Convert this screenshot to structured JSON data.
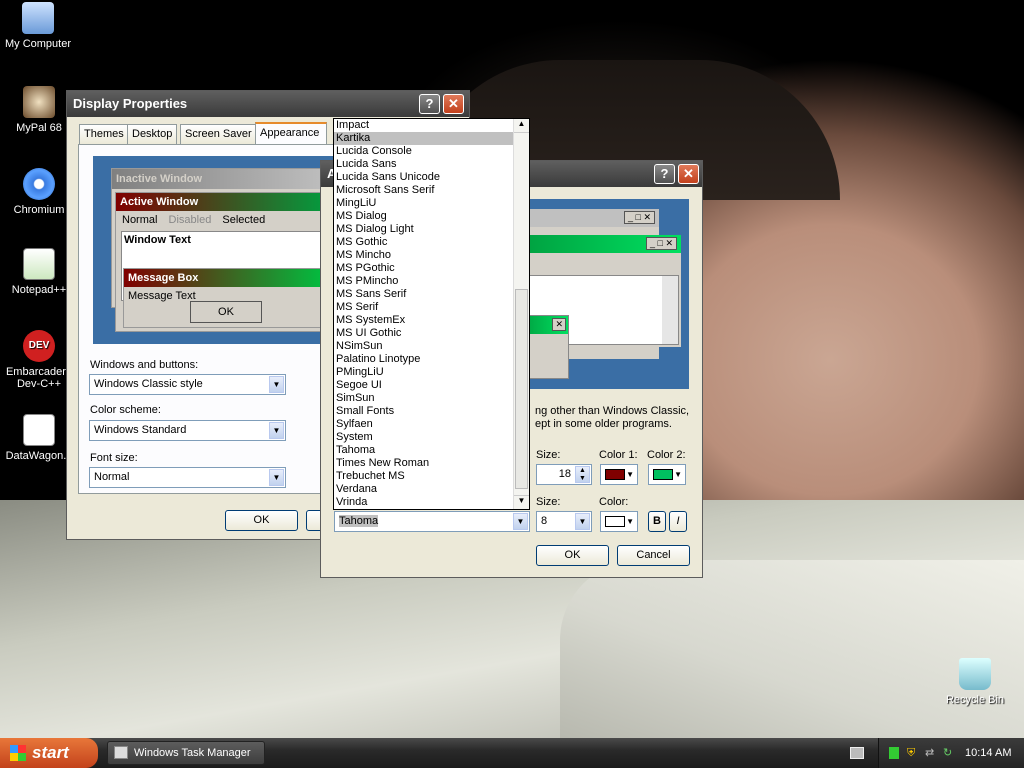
{
  "desktop": {
    "icons": [
      {
        "label": "My Computer"
      },
      {
        "label": "MyPal 68"
      },
      {
        "label": "Chromium"
      },
      {
        "label": "Notepad++"
      },
      {
        "label": "Embarcadero Dev-C++"
      },
      {
        "label": "DataWagon..."
      },
      {
        "label": "Recycle Bin"
      }
    ]
  },
  "display_props": {
    "title": "Display Properties",
    "tabs": [
      "Themes",
      "Desktop",
      "Screen Saver",
      "Appearance"
    ],
    "preview": {
      "inactive": "Inactive Window",
      "active": "Active Window",
      "menu_normal": "Normal",
      "menu_disabled": "Disabled",
      "menu_selected": "Selected",
      "window_text": "Window Text",
      "msgbox_title": "Message Box",
      "msgbox_text": "Message Text",
      "msgbox_ok": "OK"
    },
    "windows_buttons_label": "Windows and buttons:",
    "windows_buttons_value": "Windows Classic style",
    "color_scheme_label": "Color scheme:",
    "color_scheme_value": "Windows Standard",
    "font_size_label": "Font size:",
    "font_size_value": "Normal",
    "ok": "OK"
  },
  "advanced": {
    "title_initial": "A",
    "note_line1": "ng other than Windows Classic,",
    "note_line2": "ept in some older programs.",
    "size_label": "Size:",
    "size_value": "18",
    "color1_label": "Color 1:",
    "color2_label": "Color 2:",
    "color1": "#800000",
    "color2": "#00c060",
    "font_value": "Tahoma",
    "size2_label": "Size:",
    "size2_value": "8",
    "color_label": "Color:",
    "color": "#ffffff",
    "bold": "B",
    "italic": "I",
    "ok": "OK",
    "cancel": "Cancel"
  },
  "font_list": [
    "Impact",
    "Kartika",
    "Lucida Console",
    "Lucida Sans",
    "Lucida Sans Unicode",
    "Microsoft Sans Serif",
    "MingLiU",
    "MS Dialog",
    "MS Dialog Light",
    "MS Gothic",
    "MS Mincho",
    "MS PGothic",
    "MS PMincho",
    "MS Sans Serif",
    "MS Serif",
    "MS SystemEx",
    "MS UI Gothic",
    "NSimSun",
    "Palatino Linotype",
    "PMingLiU",
    "Segoe UI",
    "SimSun",
    "Small Fonts",
    "Sylfaen",
    "System",
    "Tahoma",
    "Times New Roman",
    "Trebuchet MS",
    "Verdana",
    "Vrinda"
  ],
  "font_list_highlight": "Kartika",
  "taskbar": {
    "start": "start",
    "task": "Windows Task Manager",
    "clock": "10:14 AM"
  }
}
